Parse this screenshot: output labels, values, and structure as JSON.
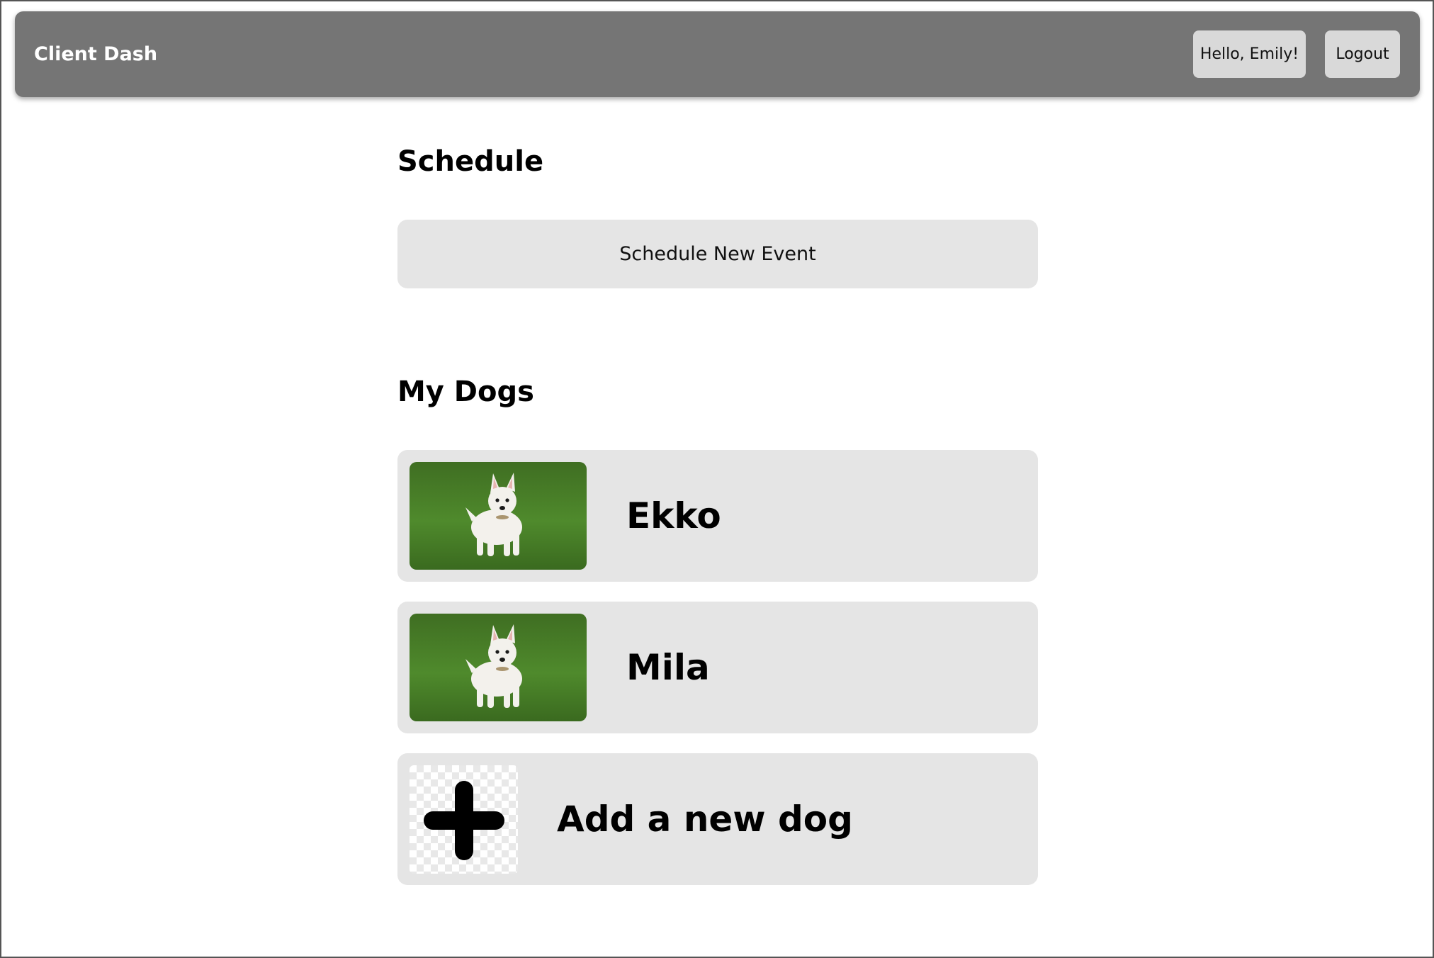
{
  "header": {
    "brand": "Client Dash",
    "greeting": "Hello, Emily!",
    "logout_label": "Logout"
  },
  "schedule": {
    "title": "Schedule",
    "new_event_label": "Schedule New Event"
  },
  "dogs": {
    "title": "My Dogs",
    "items": [
      {
        "name": "Ekko",
        "photo": "white-terrier-dog-photo"
      },
      {
        "name": "Mila",
        "photo": "white-terrier-dog-photo"
      }
    ],
    "add_label": "Add a new dog",
    "add_icon": "plus-icon"
  },
  "colors": {
    "header_bg": "#757575",
    "card_bg": "#e5e5e5",
    "button_bg": "#d9d9d9"
  }
}
